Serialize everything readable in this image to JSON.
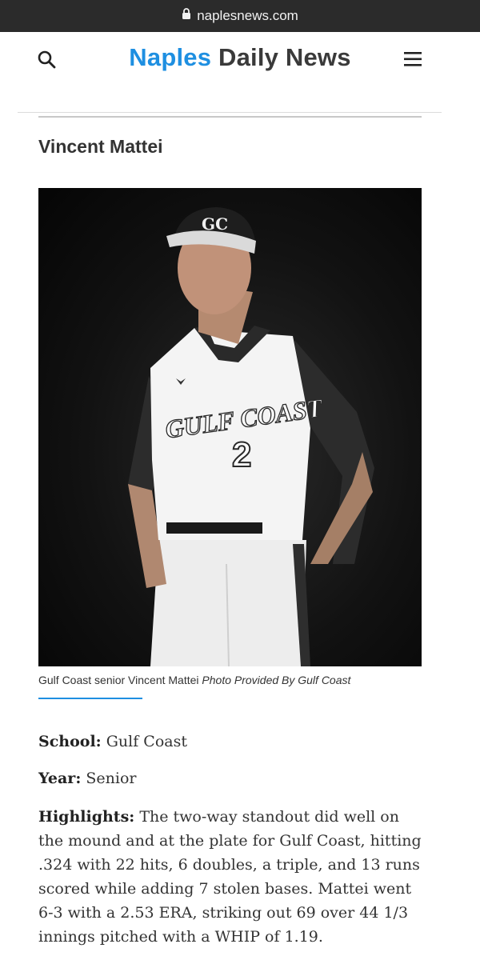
{
  "browser": {
    "url": "naplesnews.com"
  },
  "header": {
    "logo_part1": "Naples",
    "logo_part2": "Daily News",
    "colors": {
      "brand_blue": "#1e8fe1",
      "brand_dark": "#3a3a3a"
    }
  },
  "article": {
    "title": "Vincent Mattei",
    "photo": {
      "jersey_text": "GULF COAST",
      "jersey_number": "2",
      "cap_logo": "GC"
    },
    "caption": "Gulf Coast senior Vincent Mattei",
    "caption_credit": "Photo Provided By Gulf Coast",
    "school_label": "School:",
    "school_value": "Gulf Coast",
    "year_label": "Year:",
    "year_value": "Senior",
    "highlights_label": "Highlights:",
    "highlights_text": "The two-way standout did well on the mound and at the plate for Gulf Coast, hitting .324 with 22 hits, 6 doubles, a triple, and 13 runs scored while adding 7 stolen bases. Mattei went 6-3 with a 2.53 ERA, striking out 69 over 44 1/3 innings pitched with a WHIP of 1.19."
  }
}
